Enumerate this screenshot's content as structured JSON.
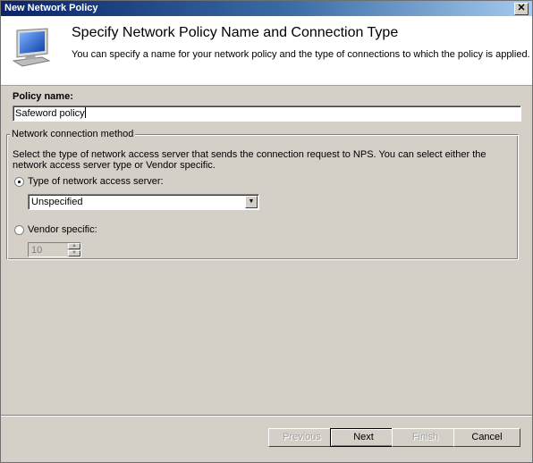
{
  "window": {
    "title": "New Network Policy",
    "close_glyph": "✕"
  },
  "header": {
    "title": "Specify Network Policy Name and Connection Type",
    "subtitle": "You can specify a name for your network policy and the type of connections to which the policy is applied.",
    "icon": "computer-monitor-icon"
  },
  "policy_name": {
    "label": "Policy name:",
    "value": "Safeword policy"
  },
  "connection_method": {
    "legend": "Network connection method",
    "description": "Select the type of network access server that sends the connection request to NPS. You can select either the network access server type or Vendor specific.",
    "type_option": {
      "label": "Type of network access server:",
      "selected": true,
      "dropdown_value": "Unspecified"
    },
    "vendor_option": {
      "label": "Vendor specific:",
      "selected": false,
      "spin_value": "10"
    }
  },
  "buttons": {
    "previous": "Previous",
    "next": "Next",
    "finish": "Finish",
    "cancel": "Cancel"
  },
  "colors": {
    "title_bar_start": "#0a246a",
    "title_bar_end": "#a6caf0",
    "dialog_face": "#d4d0c8"
  }
}
